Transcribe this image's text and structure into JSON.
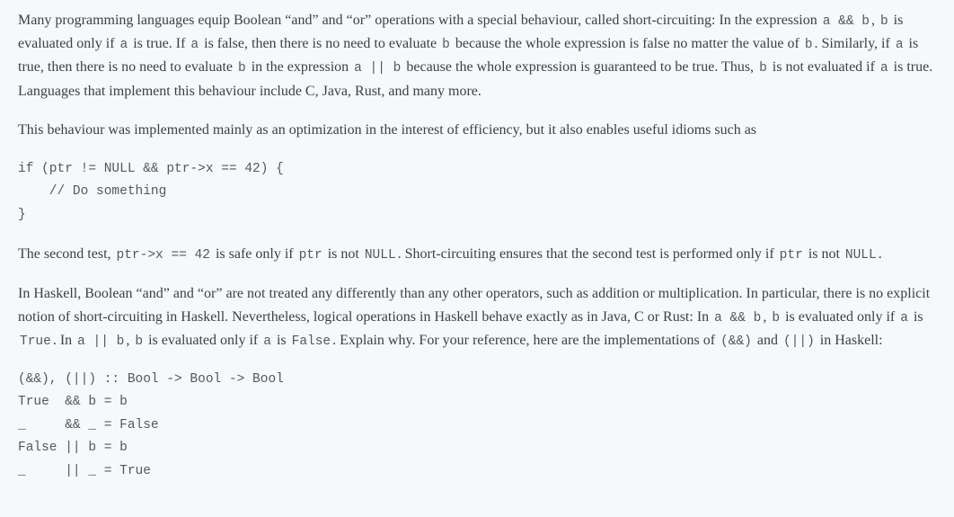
{
  "para1": {
    "t0": "Many programming languages equip Boolean “and” and “or” operations with a special behaviour, called short-circuiting: In the expression ",
    "c0": "a && b",
    "t1": ", ",
    "c1": "b",
    "t2": " is evaluated only if ",
    "c2": "a",
    "t3": " is true. If ",
    "c3": "a",
    "t4": " is false, then there is no need to evaluate ",
    "c4": "b",
    "t5": " because the whole expression is false no matter the value of ",
    "c5": "b",
    "t6": ". Similarly, if ",
    "c6": "a",
    "t7": " is true, then there is no need to evaluate ",
    "c7": "b",
    "t8": " in the expression ",
    "c8": "a || b",
    "t9": " because the whole expression is guaranteed to be true. Thus, ",
    "c9": "b",
    "t10": " is not evaluated if ",
    "c10": "a",
    "t11": " is true. Languages that implement this behaviour include C, Java, Rust, and many more."
  },
  "para2": "This behaviour was implemented mainly as an optimization in the interest of efficiency, but it also enables useful idioms such as",
  "code1": "if (ptr != NULL && ptr->x == 42) {\n    // Do something\n}",
  "para3": {
    "t0": "The second test, ",
    "c0": "ptr->x == 42",
    "t1": " is safe only if ",
    "c1": "ptr",
    "t2": " is not ",
    "c2": "NULL",
    "t3": ". Short-circuiting ensures that the second test is performed only if ",
    "c3": "ptr",
    "t4": " is not ",
    "c4": "NULL",
    "t5": "."
  },
  "para4": {
    "t0": "In Haskell, Boolean “and” and “or” are not treated any differently than any other operators, such as addition or multiplication. In particular, there is no explicit notion of short-circuiting in Haskell. Nevertheless, logical operations in Haskell behave exactly as in Java, C or Rust: In ",
    "c0": "a && b",
    "t1": ", ",
    "c1": "b",
    "t2": " is evaluated only if ",
    "c2": "a",
    "t3": " is ",
    "c3": "True",
    "t4": ". In ",
    "c4": "a || b",
    "t5": ", ",
    "c5": "b",
    "t6": " is evaluated only if ",
    "c6": "a",
    "t7": " is ",
    "c7": "False",
    "t8": ". Explain why. For your reference, here are the implementations of ",
    "c8": "(&&)",
    "t9": " and ",
    "c9": "(||)",
    "t10": " in Haskell:"
  },
  "code2": "(&&), (||) :: Bool -> Bool -> Bool\nTrue  && b = b\n_     && _ = False\nFalse || b = b\n_     || _ = True"
}
